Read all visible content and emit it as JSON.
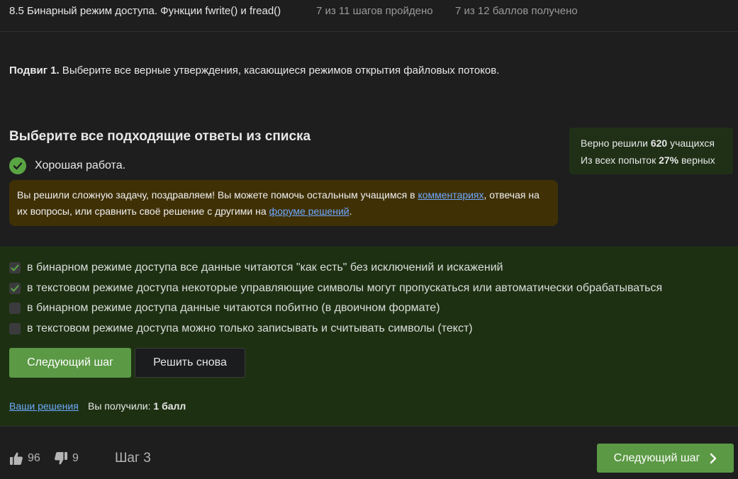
{
  "header": {
    "lesson_title": "8.5 Бинарный режим доступа. Функции fwrite() и fread()",
    "steps_progress": "7 из 11 шагов пройдено",
    "score_progress": "7 из 12 баллов  получено"
  },
  "task": {
    "label": "Подвиг 1.",
    "text": " Выберите все верные утверждения, касающиеся режимов открытия файловых потоков."
  },
  "quiz": {
    "heading": "Выберите все подходящие ответы из списка",
    "result_label": "Хорошая работа.",
    "notice": {
      "text_1": "Вы решили сложную задачу, поздравляем! Вы можете помочь остальным учащимся в ",
      "link_comments": "комментариях",
      "text_2": ", отвечая на их вопросы, или сравнить своё решение с другими на ",
      "link_forum": "форуме решений",
      "text_3": "."
    },
    "answers": [
      {
        "label": "в бинарном режиме доступа все данные читаются \"как есть\" без исключений и искажений",
        "checked": true
      },
      {
        "label": "в текстовом режиме доступа некоторые управляющие символы могут пропускаться или автоматически обрабатываться",
        "checked": true
      },
      {
        "label": "в бинарном режиме доступа данные читаются побитно (в двоичном формате)",
        "checked": false
      },
      {
        "label": "в текстовом режиме доступа можно только записывать и считывать символы (текст)",
        "checked": false
      }
    ],
    "next_button": "Следующий шаг",
    "retry_button": "Решить снова",
    "your_solutions_link": "Ваши решения",
    "got_prefix": "Вы получили: ",
    "got_value": "1 балл"
  },
  "stats": {
    "solved_prefix": "Верно решили ",
    "solved_count": "620",
    "solved_suffix": " учащихся",
    "attempts_prefix": "Из всех попыток ",
    "attempts_pct": "27%",
    "attempts_suffix": " верных"
  },
  "footer": {
    "likes": "96",
    "dislikes": "9",
    "step_label": "Шаг 3",
    "next_button": "Следующий шаг"
  },
  "colors": {
    "accent_green": "#5b9945",
    "answers_bg": "#1d3112",
    "notice_bg": "#3f3006",
    "link": "#6ea8ff"
  },
  "icons": {
    "success": "check-circle-icon",
    "checkbox_checked": "checkmark-icon",
    "like": "thumbs-up-icon",
    "dislike": "thumbs-down-icon",
    "next": "chevron-right-icon"
  }
}
